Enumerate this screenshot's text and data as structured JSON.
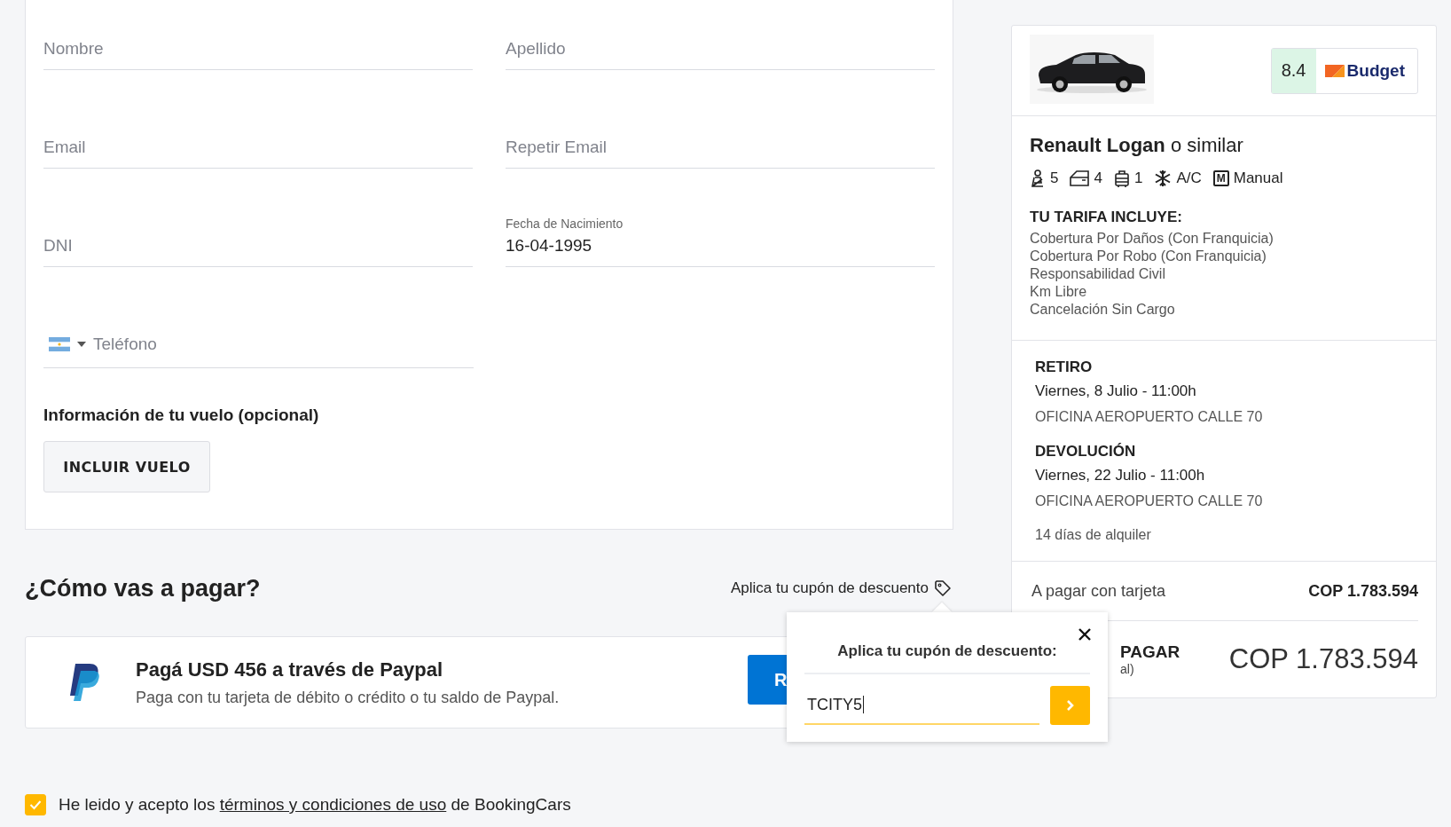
{
  "driver_form": {
    "rows": [
      [
        {
          "placeholder": "Nombre"
        },
        {
          "placeholder": "Apellido"
        }
      ],
      [
        {
          "placeholder": "Email"
        },
        {
          "placeholder": "Repetir Email"
        }
      ],
      [
        {
          "placeholder": "DNI"
        },
        {
          "label": "Fecha de Nacimiento",
          "value": "16-04-1995"
        }
      ]
    ],
    "phone": {
      "placeholder": "Teléfono"
    },
    "flight": {
      "title": "Información de tu vuelo (opcional)",
      "button": "INCLUIR VUELO"
    }
  },
  "payment": {
    "title": "¿Cómo vas a pagar?",
    "coupon_link": "Aplica tu cupón de descuento",
    "paypal": {
      "title": "Pagá USD 456 a través de Paypal",
      "subtitle": "Paga con tu tarjeta de débito o crédito o tu saldo de Paypal.",
      "button": "R"
    }
  },
  "coupon_popup": {
    "title": "Aplica tu cupón de descuento:",
    "value": "TCITY5"
  },
  "terms": {
    "checked": true,
    "before": "He leido y acepto los",
    "link": "términos y condiciones de uso",
    "after": "de BookingCars"
  },
  "summary": {
    "rating": "8.4",
    "brand": "Budget",
    "model": "Renault Logan",
    "model_suffix": "o similar",
    "features": [
      {
        "kind": "seats",
        "value": "5"
      },
      {
        "kind": "doors",
        "value": "4"
      },
      {
        "kind": "bags",
        "value": "1"
      },
      {
        "kind": "ac",
        "value": "A/C"
      },
      {
        "kind": "transmission",
        "badge": "M",
        "value": "Manual"
      }
    ],
    "includes_title": "TU TARIFA INCLUYE:",
    "includes": [
      "Cobertura Por Daños (Con Franquicia)",
      "Cobertura Por Robo (Con Franquicia)",
      "Responsabilidad Civil",
      "Km Libre",
      "Cancelación Sin Cargo"
    ],
    "legs": [
      {
        "title": "RETIRO",
        "date": "Viernes, 8 Julio - 11:00h",
        "place": "OFICINA AEROPUERTO CALLE 70"
      },
      {
        "title": "DEVOLUCIÓN",
        "date": "Viernes, 22 Julio - 11:00h",
        "place": "OFICINA AEROPUERTO CALLE 70"
      }
    ],
    "duration": "14 días de alquiler",
    "card_payment": {
      "label": "A pagar con tarjeta",
      "amount": "COP 1.783.594"
    },
    "total": {
      "label": "PAGAR",
      "note": "al)",
      "amount": "COP 1.783.594"
    }
  }
}
